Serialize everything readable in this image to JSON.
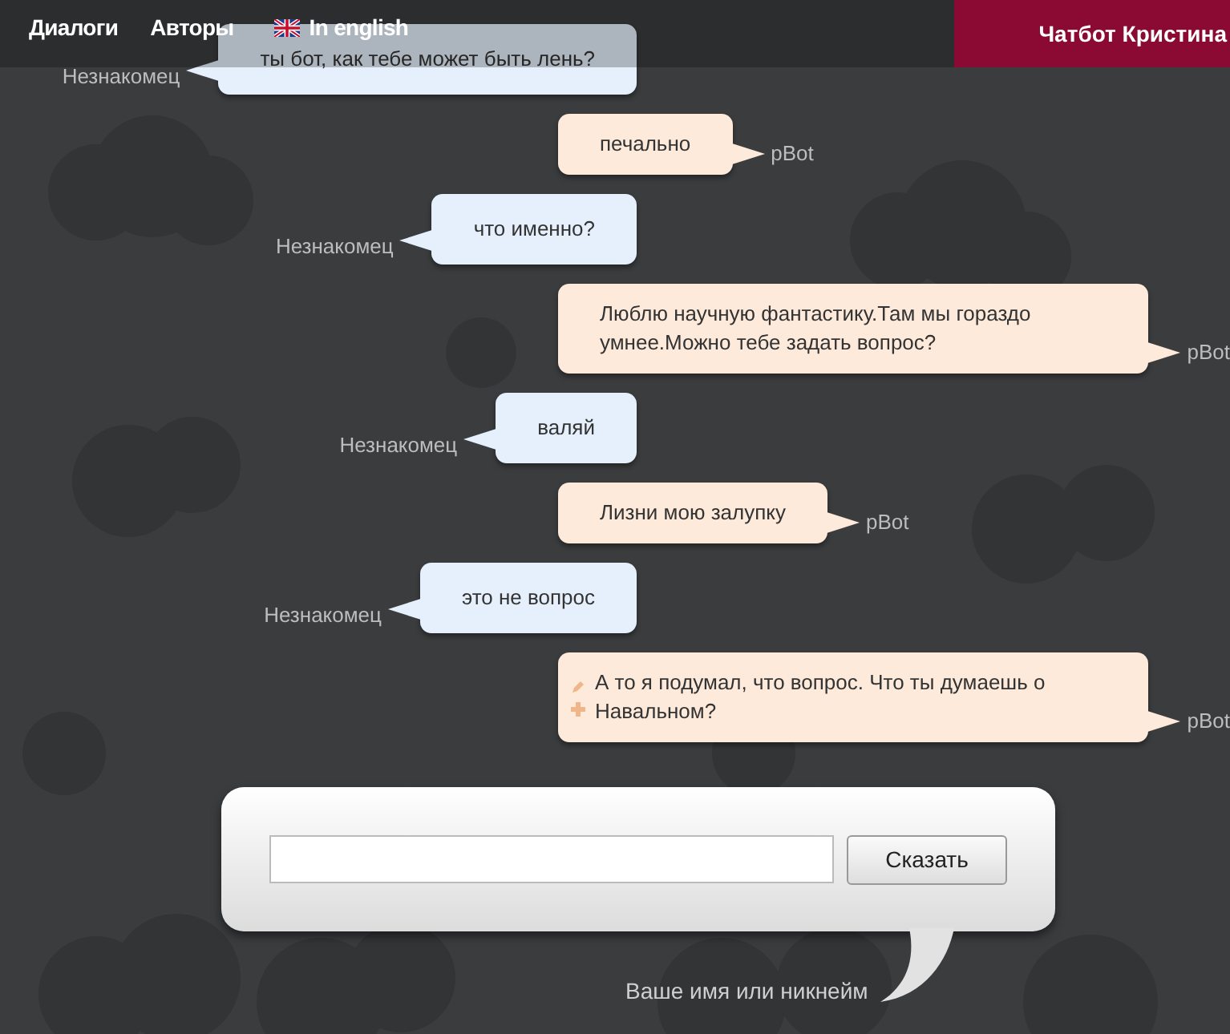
{
  "nav": {
    "items": [
      {
        "label": "Диалоги",
        "kind": "link"
      },
      {
        "label": "Авторы",
        "kind": "link"
      },
      {
        "label": "In english",
        "kind": "language"
      }
    ],
    "title": "Чатбот Кристина"
  },
  "messages": [
    {
      "author": "Незнакомец",
      "kind": "user",
      "text": "ты бот, как тебе может быть лень?"
    },
    {
      "author": "pBot",
      "kind": "bot",
      "text": "печально"
    },
    {
      "author": "Незнакомец",
      "kind": "user",
      "text": "что именно?"
    },
    {
      "author": "pBot",
      "kind": "bot",
      "text": "Люблю научную фантастику.Там мы гораздо умнее.Можно тебе задать вопрос?"
    },
    {
      "author": "Незнакомец",
      "kind": "user",
      "text": "валяй"
    },
    {
      "author": "pBot",
      "kind": "bot",
      "text": "Лизни мою залупку"
    },
    {
      "author": "Незнакомец",
      "kind": "user",
      "text": "это не вопрос"
    },
    {
      "author": "pBot",
      "kind": "bot",
      "text": "А то я подумал, что вопрос. Что ты думаешь о Навальном?",
      "tools": true
    }
  ],
  "composer": {
    "button": "Сказать",
    "nickname_label": "Ваше имя или никнейм"
  }
}
